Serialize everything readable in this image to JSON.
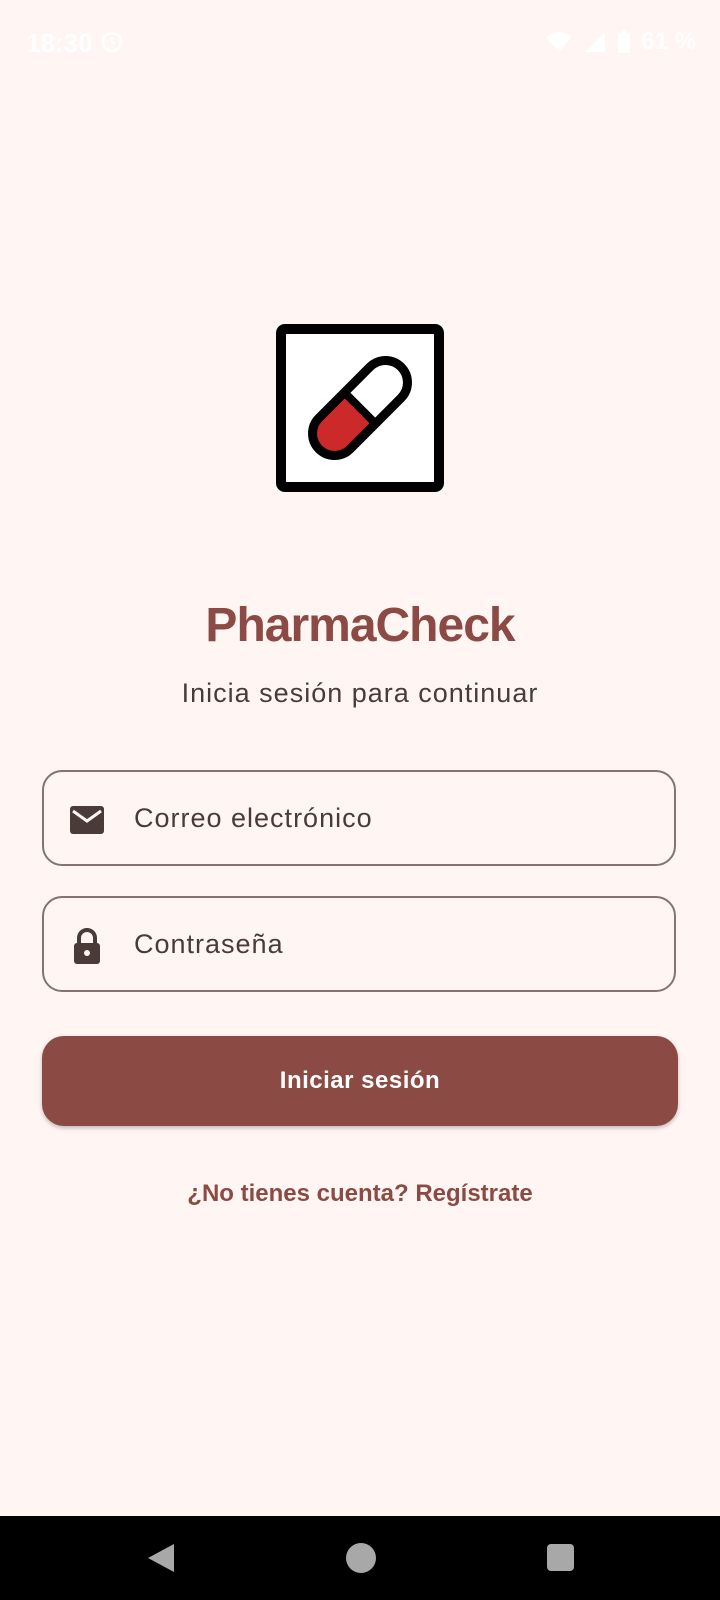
{
  "status_bar": {
    "time": "18:30",
    "battery": "61 %",
    "icons": [
      "sync-icon",
      "wifi-icon",
      "signal-icon",
      "battery-icon"
    ]
  },
  "app": {
    "logo_icon": "pill-capsule-icon",
    "title": "PharmaCheck",
    "subtitle": "Inicia sesión para continuar"
  },
  "form": {
    "email": {
      "icon": "mail-icon",
      "placeholder": "Correo electrónico",
      "value": ""
    },
    "password": {
      "icon": "lock-icon",
      "placeholder": "Contraseña",
      "value": ""
    },
    "login_button_label": "Iniciar sesión",
    "register_link": "¿No tienes cuenta? Regístrate"
  },
  "nav_bar": {
    "icons": [
      "back-icon",
      "home-icon",
      "recents-icon"
    ]
  },
  "colors": {
    "background": "#fff5f3",
    "primary": "#8c4a44",
    "text": "#4a3b39",
    "outline": "#857371",
    "pill_red": "#cc2a2a"
  }
}
